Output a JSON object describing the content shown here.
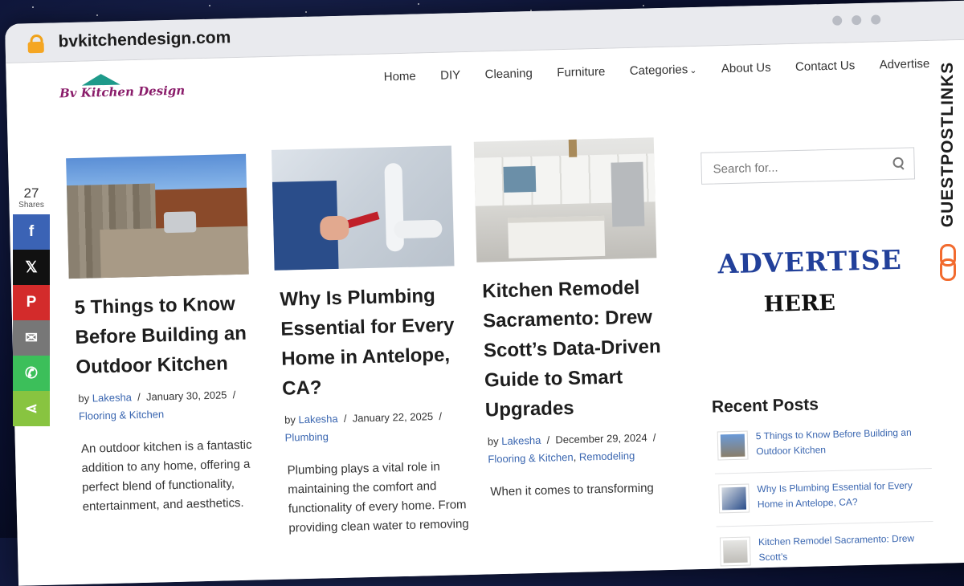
{
  "browser": {
    "url": "bvkitchendesign.com"
  },
  "site": {
    "logo_text": "Bv Kitchen Design",
    "nav": [
      "Home",
      "DIY",
      "Cleaning",
      "Furniture",
      "Categories",
      "About Us",
      "Contact Us",
      "Advertise"
    ]
  },
  "posts": [
    {
      "title": "5 Things to Know Before Building an Outdoor Kitchen",
      "by": "by",
      "author": "Lakesha",
      "date": "January 30, 2025",
      "categories": "Flooring & Kitchen",
      "excerpt": "An outdoor kitchen is a fantastic addition to any home, offering a perfect blend of functionality, entertainment, and aesthetics."
    },
    {
      "title": "Why Is Plumbing Essential for Every Home in Antelope, CA?",
      "by": "by",
      "author": "Lakesha",
      "date": "January 22, 2025",
      "categories": "Plumbing",
      "excerpt": "Plumbing plays a vital role in maintaining the comfort and functionality of every home. From providing clean water to removing"
    },
    {
      "title": "Kitchen Remodel Sacramento: Drew Scott’s Data-Driven Guide to Smart Upgrades",
      "by": "by",
      "author": "Lakesha",
      "date": "December 29, 2024",
      "category_1": "Flooring & Kitchen",
      "category_2": "Remodeling",
      "excerpt": "When it comes to transforming"
    }
  ],
  "sidebar": {
    "search_placeholder": "Search for...",
    "advert_line1": "ADVERTISE",
    "advert_line2": "HERE",
    "recent_title": "Recent Posts",
    "recent": [
      "5 Things to Know Before Building an Outdoor Kitchen",
      "Why Is Plumbing Essential for Every Home in Antelope, CA?",
      "Kitchen Remodel Sacramento: Drew Scott’s"
    ]
  },
  "share": {
    "count": "27",
    "label": "Shares",
    "buttons": [
      {
        "icon": "facebook-icon",
        "glyph": "f",
        "color": "#3b63b5"
      },
      {
        "icon": "x-icon",
        "glyph": "𝕏",
        "color": "#111111"
      },
      {
        "icon": "pinterest-icon",
        "glyph": "P",
        "color": "#d32b2b"
      },
      {
        "icon": "email-icon",
        "glyph": "✉",
        "color": "#777777"
      },
      {
        "icon": "whatsapp-icon",
        "glyph": "✆",
        "color": "#3cbf5a"
      },
      {
        "icon": "share-icon",
        "glyph": "⋖",
        "color": "#88c440"
      }
    ]
  },
  "watermark": {
    "text": "GUESTPOSTLINKS"
  }
}
